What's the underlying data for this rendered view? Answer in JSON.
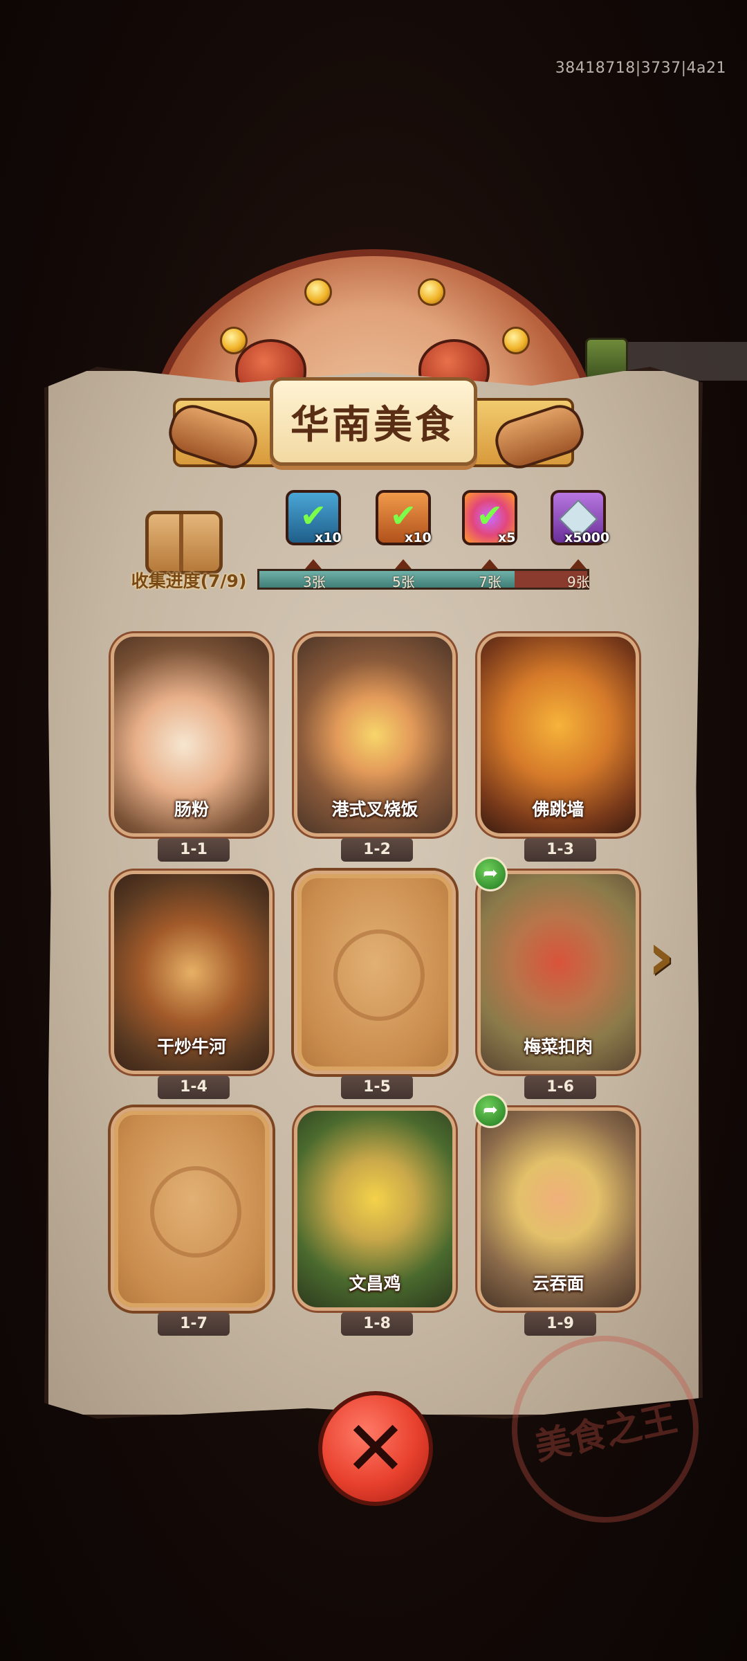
{
  "build_id": "38418718|3737|4a21",
  "title": "华南美食",
  "collection": {
    "progress_label": "收集进度(7/9)",
    "collected": 7,
    "total": 9
  },
  "rewards": [
    {
      "icon": "blue-chest-check-icon",
      "count": "x10",
      "tier": "3张"
    },
    {
      "icon": "orange-scroll-check-icon",
      "count": "x10",
      "tier": "5张"
    },
    {
      "icon": "rainbow-orb-check-icon",
      "count": "x5",
      "tier": "7张"
    },
    {
      "icon": "purple-crystal-icon",
      "count": "x5000",
      "tier": "9张"
    }
  ],
  "cards": [
    {
      "name": "肠粉",
      "num": "1-1",
      "locked": false,
      "share": false
    },
    {
      "name": "港式叉烧饭",
      "num": "1-2",
      "locked": false,
      "share": false
    },
    {
      "name": "佛跳墙",
      "num": "1-3",
      "locked": false,
      "share": false
    },
    {
      "name": "干炒牛河",
      "num": "1-4",
      "locked": false,
      "share": false
    },
    {
      "name": "",
      "num": "1-5",
      "locked": true,
      "share": false
    },
    {
      "name": "梅菜扣肉",
      "num": "1-6",
      "locked": false,
      "share": true
    },
    {
      "name": "",
      "num": "1-7",
      "locked": true,
      "share": false
    },
    {
      "name": "文昌鸡",
      "num": "1-8",
      "locked": false,
      "share": false
    },
    {
      "name": "云吞面",
      "num": "1-9",
      "locked": false,
      "share": true
    }
  ],
  "icons": {
    "share": "share-arrow-icon",
    "next": "chevron-right-icon",
    "close": "close-icon",
    "book": "collection-book-icon"
  },
  "stamp_text": "美食之王"
}
